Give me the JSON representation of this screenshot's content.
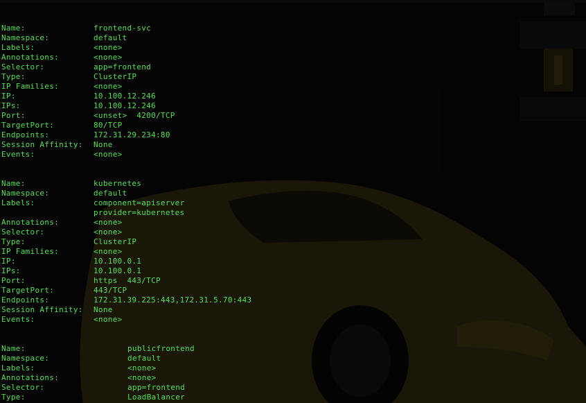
{
  "colors": {
    "terminal_text": "#53e053",
    "background": "#0b0b0b"
  },
  "services": [
    {
      "rows": [
        {
          "key": "Name:",
          "value": "frontend-svc"
        },
        {
          "key": "Namespace:",
          "value": "default"
        },
        {
          "key": "Labels:",
          "value": "<none>"
        },
        {
          "key": "Annotations:",
          "value": "<none>"
        },
        {
          "key": "Selector:",
          "value": "app=frontend"
        },
        {
          "key": "Type:",
          "value": "ClusterIP"
        },
        {
          "key": "IP Families:",
          "value": "<none>"
        },
        {
          "key": "IP:",
          "value": "10.100.12.246"
        },
        {
          "key": "IPs:",
          "value": "10.100.12.246"
        },
        {
          "key": "Port:",
          "value": "<unset>  4200/TCP"
        },
        {
          "key": "TargetPort:",
          "value": "80/TCP"
        },
        {
          "key": "Endpoints:",
          "value": "172.31.29.234:80"
        },
        {
          "key": "Session Affinity:",
          "value": "None"
        },
        {
          "key": "Events:",
          "value": "<none>"
        }
      ]
    },
    {
      "rows": [
        {
          "key": "Name:",
          "value": "kubernetes"
        },
        {
          "key": "Namespace:",
          "value": "default"
        },
        {
          "key": "Labels:",
          "value": "component=apiserver"
        },
        {
          "key": "",
          "value": "provider=kubernetes"
        },
        {
          "key": "Annotations:",
          "value": "<none>"
        },
        {
          "key": "Selector:",
          "value": "<none>"
        },
        {
          "key": "Type:",
          "value": "ClusterIP"
        },
        {
          "key": "IP Families:",
          "value": "<none>"
        },
        {
          "key": "IP:",
          "value": "10.100.0.1"
        },
        {
          "key": "IPs:",
          "value": "10.100.0.1"
        },
        {
          "key": "Port:",
          "value": "https  443/TCP"
        },
        {
          "key": "TargetPort:",
          "value": "443/TCP"
        },
        {
          "key": "Endpoints:",
          "value": "172.31.39.225:443,172.31.5.70:443"
        },
        {
          "key": "Session Affinity:",
          "value": "None"
        },
        {
          "key": "Events:",
          "value": "<none>"
        }
      ]
    },
    {
      "rows": [
        {
          "key": "Name:",
          "value": "publicfrontend"
        },
        {
          "key": "Namespace:",
          "value": "default"
        },
        {
          "key": "Labels:",
          "value": "<none>"
        },
        {
          "key": "Annotations:",
          "value": "<none>"
        },
        {
          "key": "Selector:",
          "value": "app=frontend"
        },
        {
          "key": "Type:",
          "value": "LoadBalancer"
        }
      ]
    }
  ]
}
